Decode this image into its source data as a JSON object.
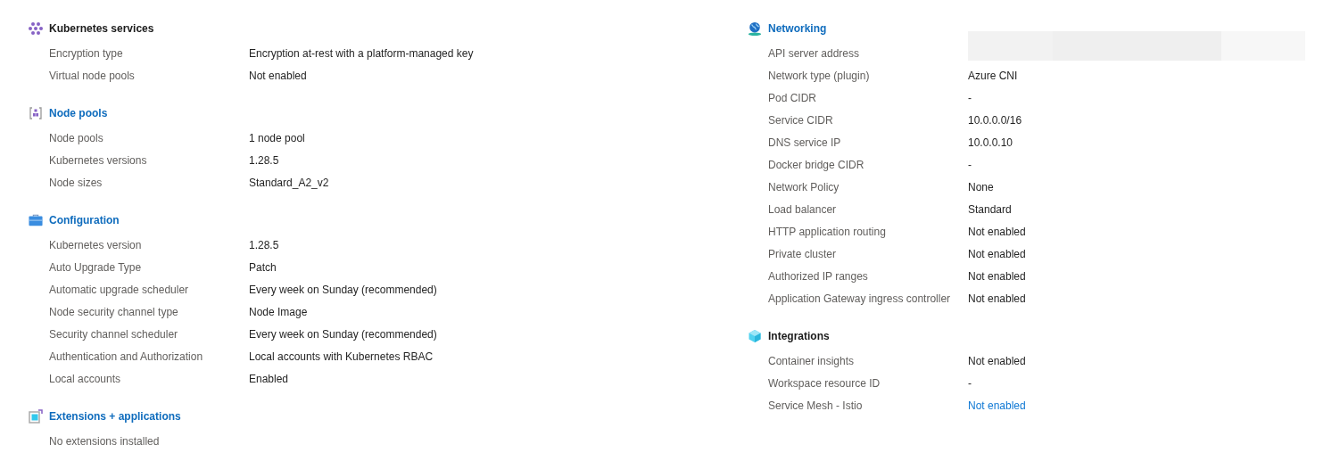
{
  "columns": [
    {
      "sections": [
        {
          "title": "Kubernetes services",
          "link": false,
          "rows": [
            {
              "kind": "text",
              "label": "Encryption type",
              "value": "Encryption at-rest with a platform-managed key"
            },
            {
              "kind": "text",
              "label": "Virtual node pools",
              "value": "Not enabled"
            }
          ]
        },
        {
          "title": "Node pools",
          "link": true,
          "rows": [
            {
              "kind": "text",
              "label": "Node pools",
              "value": "1 node pool"
            },
            {
              "kind": "text",
              "label": "Kubernetes versions",
              "value": "1.28.5"
            },
            {
              "kind": "text",
              "label": "Node sizes",
              "value": "Standard_A2_v2"
            }
          ]
        },
        {
          "title": "Configuration",
          "link": true,
          "rows": [
            {
              "kind": "text",
              "label": "Kubernetes version",
              "value": "1.28.5"
            },
            {
              "kind": "text",
              "label": "Auto Upgrade Type",
              "value": "Patch"
            },
            {
              "kind": "text",
              "label": "Automatic upgrade scheduler",
              "value": "Every week on Sunday (recommended)"
            },
            {
              "kind": "text",
              "label": "Node security channel type",
              "value": "Node Image"
            },
            {
              "kind": "text",
              "label": "Security channel scheduler",
              "value": "Every week on Sunday (recommended)"
            },
            {
              "kind": "text",
              "label": "Authentication and Authorization",
              "value": "Local accounts with Kubernetes RBAC"
            },
            {
              "kind": "text",
              "label": "Local accounts",
              "value": "Enabled"
            }
          ]
        },
        {
          "title": "Extensions + applications",
          "link": true,
          "rows": [
            {
              "kind": "note",
              "label": "No extensions installed"
            }
          ]
        }
      ]
    },
    {
      "sections": [
        {
          "title": "Networking",
          "link": true,
          "rows": [
            {
              "kind": "redacted",
              "label": "API server address"
            },
            {
              "kind": "text",
              "label": "Network type (plugin)",
              "value": "Azure CNI"
            },
            {
              "kind": "text",
              "label": "Pod CIDR",
              "value": "-"
            },
            {
              "kind": "text",
              "label": "Service CIDR",
              "value": "10.0.0.0/16"
            },
            {
              "kind": "text",
              "label": "DNS service IP",
              "value": "10.0.0.10"
            },
            {
              "kind": "text",
              "label": "Docker bridge CIDR",
              "value": "-"
            },
            {
              "kind": "text",
              "label": "Network Policy",
              "value": "None"
            },
            {
              "kind": "text",
              "label": "Load balancer",
              "value": "Standard"
            },
            {
              "kind": "text",
              "label": "HTTP application routing",
              "value": "Not enabled"
            },
            {
              "kind": "text",
              "label": "Private cluster",
              "value": "Not enabled"
            },
            {
              "kind": "text",
              "label": "Authorized IP ranges",
              "value": "Not enabled"
            },
            {
              "kind": "text",
              "label": "Application Gateway ingress controller",
              "value": "Not enabled"
            }
          ]
        },
        {
          "title": "Integrations",
          "link": false,
          "rows": [
            {
              "kind": "text",
              "label": "Container insights",
              "value": "Not enabled"
            },
            {
              "kind": "text",
              "label": "Workspace resource ID",
              "value": "-"
            },
            {
              "kind": "link",
              "label": "Service Mesh - Istio",
              "value": "Not enabled"
            }
          ]
        }
      ]
    }
  ]
}
